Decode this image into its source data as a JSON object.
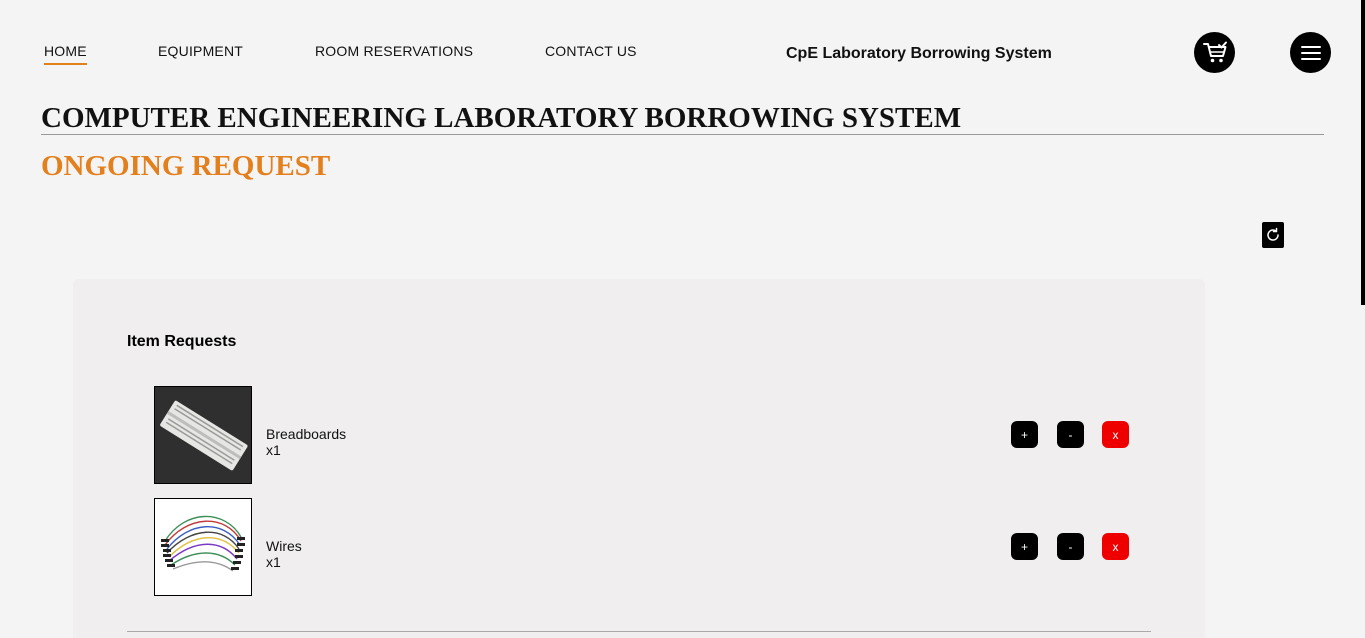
{
  "nav": {
    "items": [
      {
        "label": "HOME",
        "active": true
      },
      {
        "label": "EQUIPMENT",
        "active": false
      },
      {
        "label": "ROOM RESERVATIONS",
        "active": false
      },
      {
        "label": "CONTACT US",
        "active": false
      }
    ],
    "brand": "CpE Laboratory Borrowing System",
    "cart_icon": "cart-check-icon",
    "menu_icon": "hamburger-menu-icon"
  },
  "page": {
    "title": "COMPUTER ENGINEERING LABORATORY BORROWING SYSTEM",
    "section_title": "ONGOING REQUEST",
    "refresh_icon": "refresh-icon"
  },
  "requests": {
    "heading": "Item Requests",
    "items": [
      {
        "name": "Breadboards",
        "qty": "x1",
        "image": "breadboard-image"
      },
      {
        "name": "Wires",
        "qty": "x1",
        "image": "jumper-wires-image"
      }
    ],
    "buttons": {
      "add": "+",
      "subtract": "-",
      "remove": "x"
    }
  },
  "colors": {
    "accent": "#e37f1c",
    "remove": "#ee0000",
    "background": "#f4f4f4",
    "panel": "#f0eeee"
  }
}
